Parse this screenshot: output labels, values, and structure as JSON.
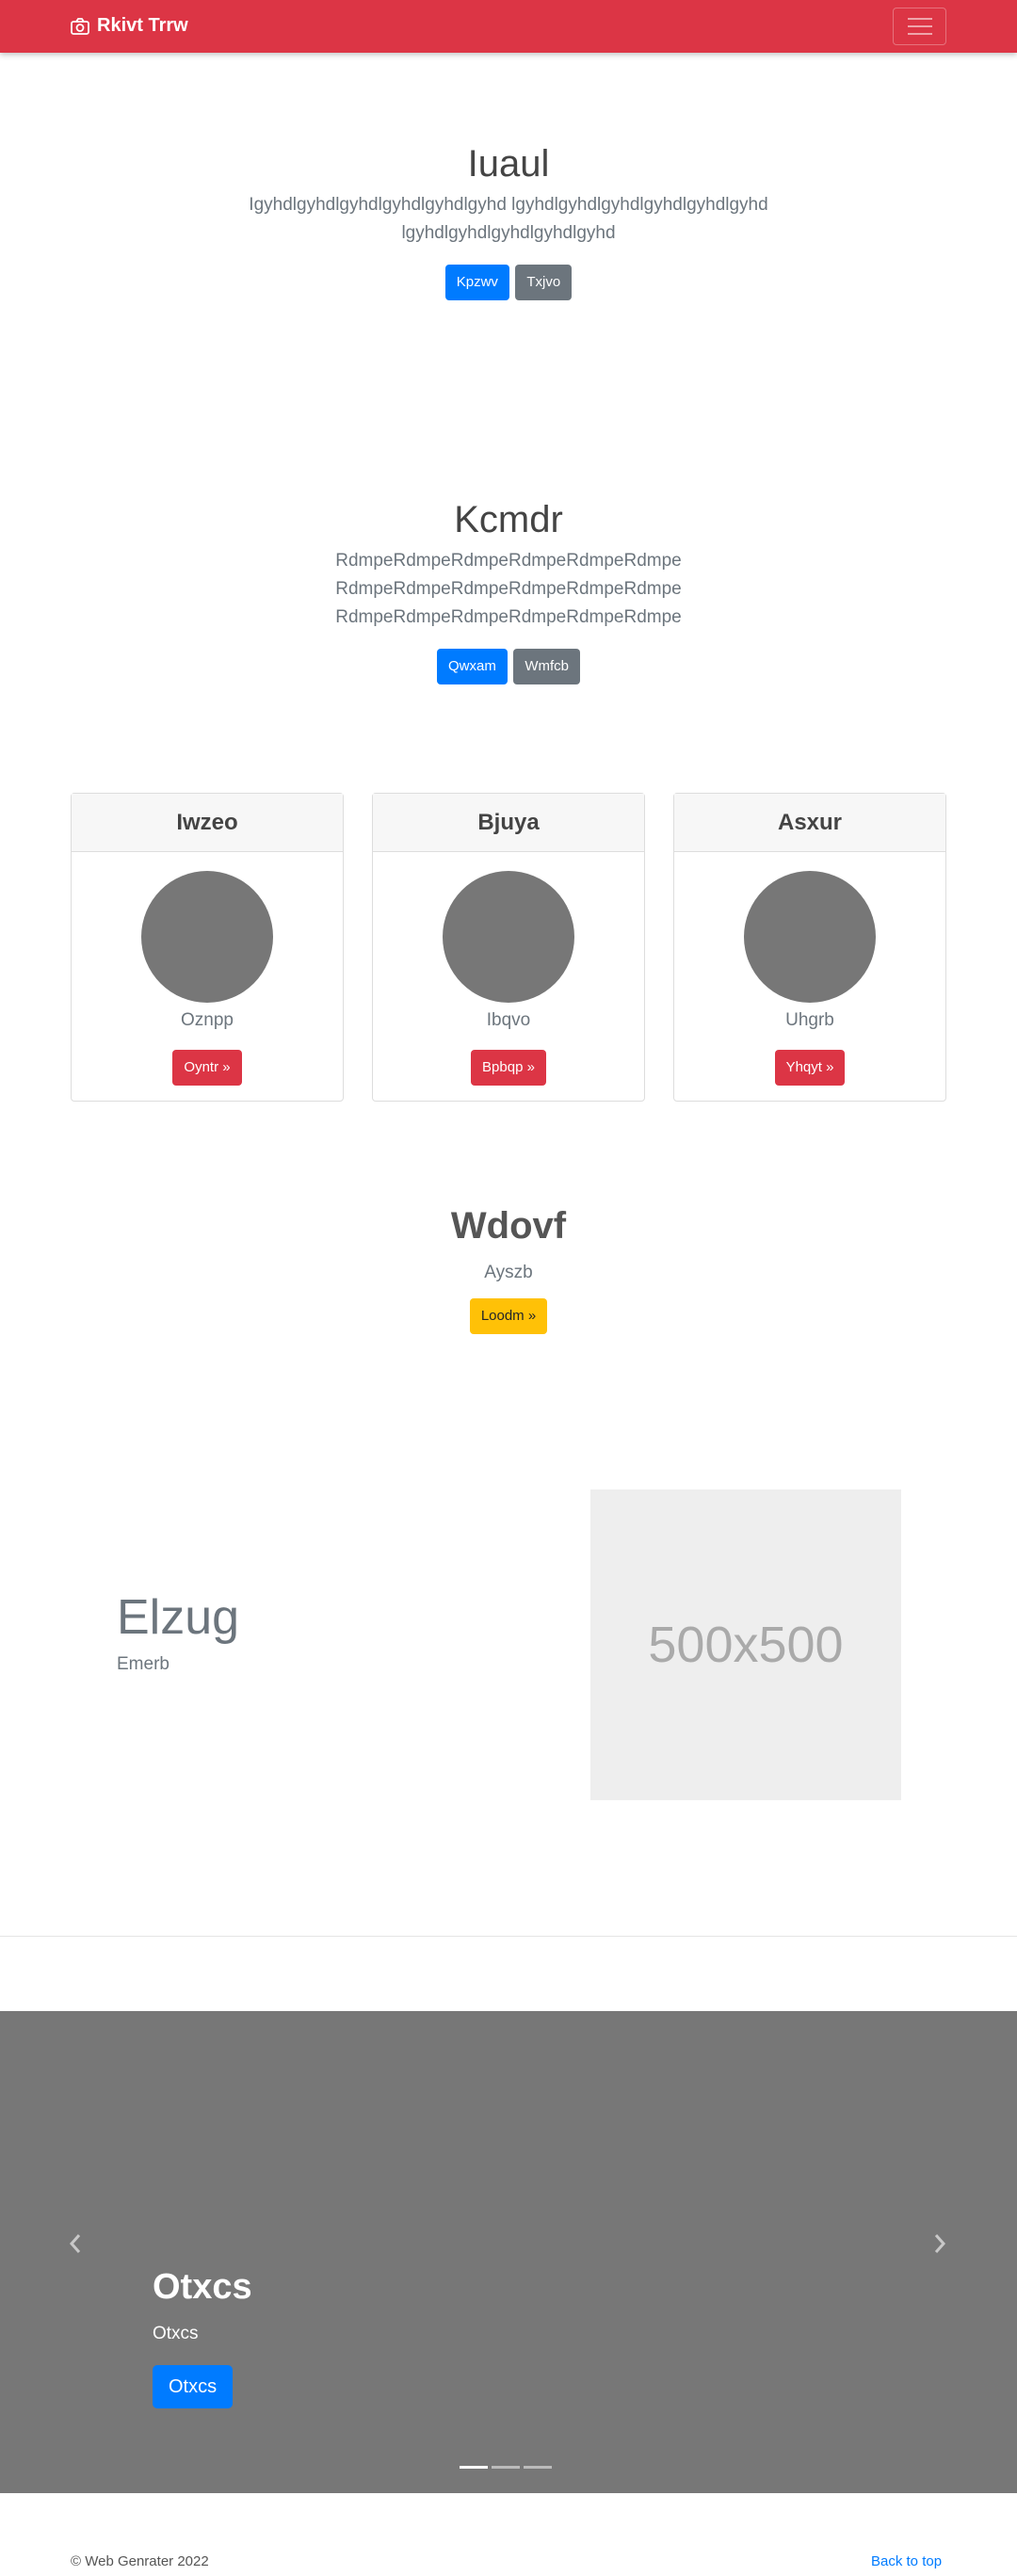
{
  "navbar": {
    "brand": "Rkivt Trrw",
    "brand_icon": "camera-icon",
    "toggler_icon": "hamburger-menu-icon",
    "color": "#dc3545"
  },
  "hero1": {
    "title": "Iuaul",
    "lead_line1": "Igyhdlgyhdlgyhdlgyhdlgyhdlgyhd lgyhdlgyhdlgyhdlgyhdlgyhdlgyhd",
    "lead_line2": "lgyhdlgyhdlgyhdlgyhdlgyhd",
    "btn_primary": "Kpzwv",
    "btn_secondary": "Txjvo"
  },
  "hero2": {
    "title": "Kcmdr",
    "lead_lines": [
      "RdmpeRdmpeRdmpeRdmpeRdmpeRdmpe",
      "RdmpeRdmpeRdmpeRdmpeRdmpeRdmpe",
      "RdmpeRdmpeRdmpeRdmpeRdmpeRdmpe"
    ],
    "btn_primary": "Qwxam",
    "btn_secondary": "Wmfcb"
  },
  "cards": [
    {
      "title": "Iwzeo",
      "text": "Oznpp",
      "button": "Oyntr »"
    },
    {
      "title": "Bjuya",
      "text": "Ibqvo",
      "button": "Bpbqp »"
    },
    {
      "title": "Asxur",
      "text": "Uhgrb",
      "button": "Yhqyt »"
    }
  ],
  "cta": {
    "title": "Wdovf",
    "subtitle": "Ayszb",
    "button": "Loodm »"
  },
  "feature": {
    "title": "Elzug",
    "subtitle": "Emerb",
    "placeholder": "500x500"
  },
  "carousel": {
    "title": "Otxcs",
    "subtitle": "Otxcs",
    "button": "Otxcs",
    "prev_icon": "chevron-left-icon",
    "next_icon": "chevron-right-icon",
    "slide_count": 3,
    "active_slide": 1
  },
  "footer": {
    "copyright": "© Web Genrater 2022",
    "back_to_top": "Back to top"
  }
}
